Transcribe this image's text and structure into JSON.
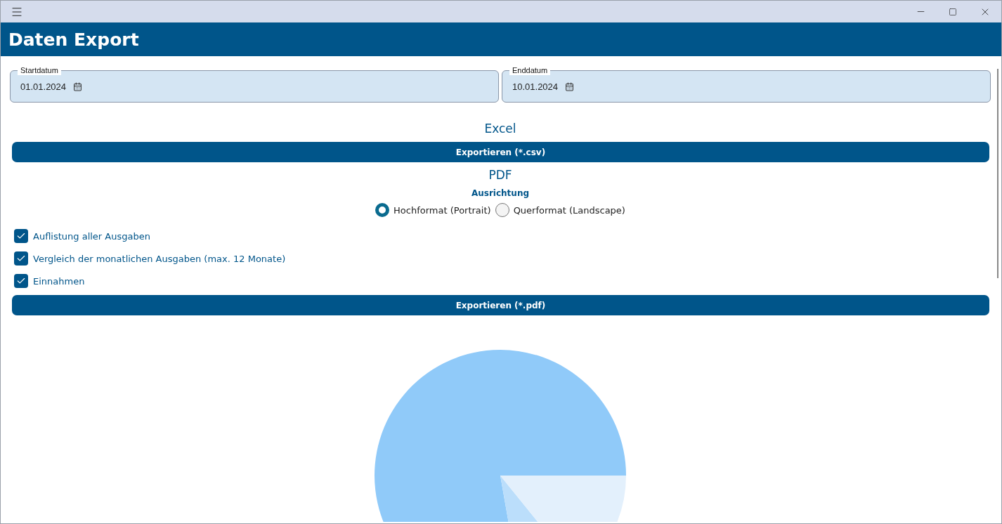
{
  "window": {
    "title": "Daten Export"
  },
  "date_fields": [
    {
      "label": "Startdatum",
      "value": "01.01.2024"
    },
    {
      "label": "Enddatum",
      "value": "10.01.2024"
    }
  ],
  "excel": {
    "heading": "Excel",
    "button": "Exportieren (*.csv)"
  },
  "pdf": {
    "heading": "PDF",
    "orientation_label": "Ausrichtung",
    "orientations": [
      {
        "label": "Hochformat (Portrait)",
        "selected": true
      },
      {
        "label": "Querformat (Landscape)",
        "selected": false
      }
    ],
    "options": [
      {
        "label": "Auflistung aller Ausgaben",
        "checked": true
      },
      {
        "label": "Vergleich der monatlichen Ausgaben (max. 12 Monate)",
        "checked": true
      },
      {
        "label": "Einnahmen",
        "checked": true
      }
    ],
    "button": "Exportieren (*.pdf)"
  }
}
